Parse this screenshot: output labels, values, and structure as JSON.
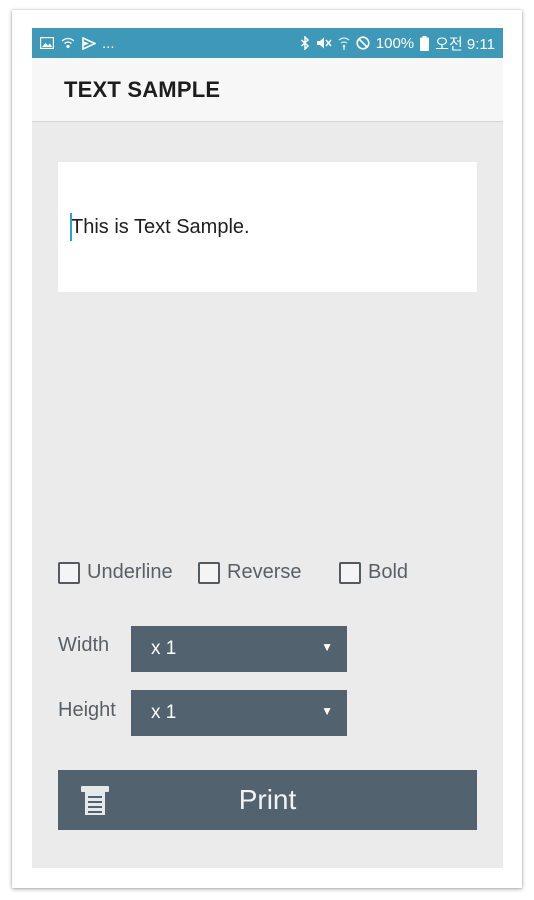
{
  "status_bar": {
    "left_icons": [
      "image-icon",
      "wifi-direct-icon",
      "cast-icon"
    ],
    "left_more": "...",
    "right_icons": [
      "bluetooth-icon",
      "mute-icon",
      "signal-icon",
      "no-disturb-icon"
    ],
    "battery": "100%",
    "time": "오전 9:11"
  },
  "app_bar": {
    "title": "TEXT SAMPLE"
  },
  "text_input": {
    "value": "This is Text Sample."
  },
  "options": {
    "underline": {
      "label": "Underline",
      "checked": false
    },
    "reverse": {
      "label": "Reverse",
      "checked": false
    },
    "bold": {
      "label": "Bold",
      "checked": false
    }
  },
  "width": {
    "label": "Width",
    "value": "x 1"
  },
  "height": {
    "label": "Height",
    "value": "x 1"
  },
  "print_button": {
    "label": "Print",
    "icon": "printer-icon"
  },
  "colors": {
    "status_bar": "#3e98b8",
    "control": "#53626f",
    "background": "#ebebeb"
  }
}
